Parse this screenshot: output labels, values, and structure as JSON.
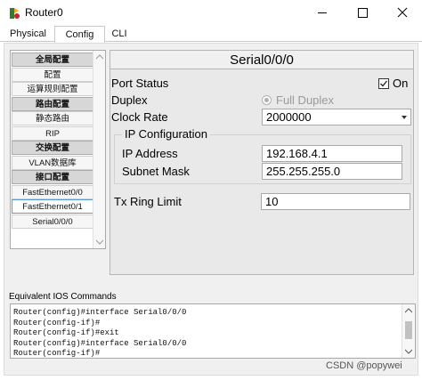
{
  "window": {
    "title": "Router0",
    "icons": [
      "router-app-icon",
      "minimize-icon",
      "maximize-icon",
      "close-icon"
    ]
  },
  "tabs": [
    {
      "label": "Physical"
    },
    {
      "label": "Config"
    },
    {
      "label": "CLI"
    }
  ],
  "sidebar": {
    "items": [
      {
        "label": "全局配置",
        "kind": "header"
      },
      {
        "label": "配置",
        "kind": "item"
      },
      {
        "label": "运算规则配置",
        "kind": "item"
      },
      {
        "label": "路由配置",
        "kind": "header"
      },
      {
        "label": "静态路由",
        "kind": "item"
      },
      {
        "label": "RIP",
        "kind": "item"
      },
      {
        "label": "交换配置",
        "kind": "header"
      },
      {
        "label": "VLAN数据库",
        "kind": "item"
      },
      {
        "label": "接口配置",
        "kind": "header"
      },
      {
        "label": "FastEthernet0/0",
        "kind": "item"
      },
      {
        "label": "FastEthernet0/1",
        "kind": "selected"
      },
      {
        "label": "Serial0/0/0",
        "kind": "item"
      }
    ]
  },
  "panel": {
    "title": "Serial0/0/0",
    "port_status": {
      "label": "Port Status",
      "option": "On",
      "checked": true
    },
    "duplex": {
      "label": "Duplex",
      "option": "Full Duplex",
      "selected": true,
      "enabled": false
    },
    "clock_rate": {
      "label": "Clock Rate",
      "value": "2000000"
    },
    "ip_config": {
      "title": "IP Configuration",
      "ip_label": "IP Address",
      "ip_value": "192.168.4.1",
      "mask_label": "Subnet Mask",
      "mask_value": "255.255.255.0"
    },
    "tx_ring": {
      "label": "Tx Ring Limit",
      "value": "10"
    }
  },
  "console": {
    "label": "Equivalent IOS Commands",
    "lines": [
      "Router(config)#interface Serial0/0/0",
      "Router(config-if)#",
      "Router(config-if)#exit",
      "Router(config)#interface Serial0/0/0",
      "Router(config-if)#"
    ]
  },
  "watermark": "CSDN @popywei"
}
